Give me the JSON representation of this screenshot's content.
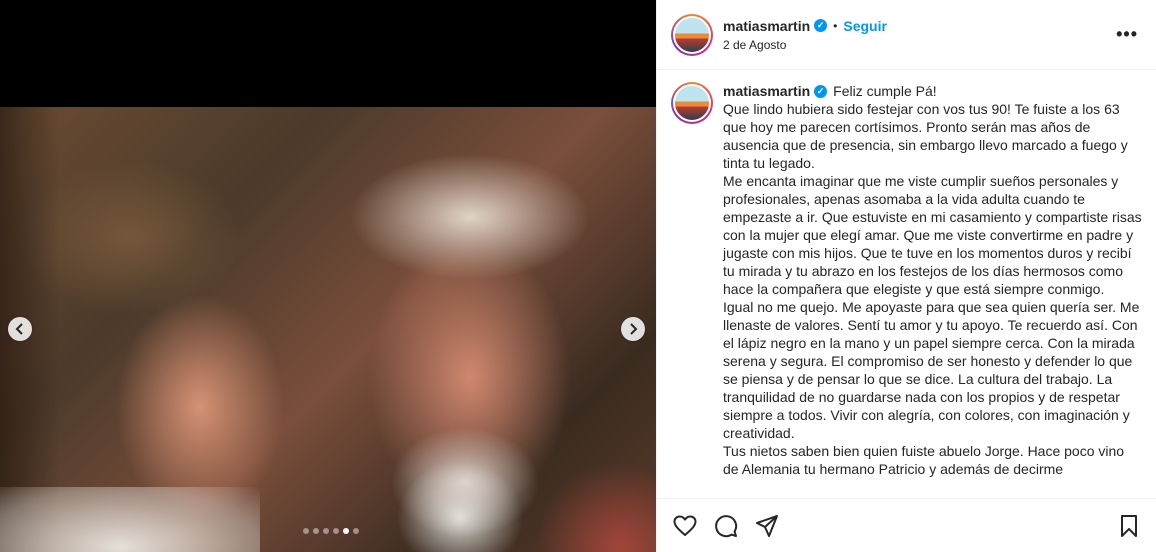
{
  "post": {
    "username": "matiasmartin",
    "separator": "•",
    "follow_label": "Seguir",
    "date": "2 de Agosto",
    "more_label": "•••"
  },
  "media": {
    "prev_icon": "chevron-left-icon",
    "next_icon": "chevron-right-icon",
    "carousel_count": 6,
    "carousel_active_index": 4
  },
  "caption": {
    "username": "matiasmartin",
    "first_line": "Feliz cumple Pá!",
    "paragraphs": [
      "Que lindo hubiera sido festejar con vos tus 90! Te fuiste a los 63 que hoy me parecen cortísimos. Pronto serán mas años de ausencia que de presencia, sin embargo llevo marcado a fuego y tinta tu legado.",
      "Me encanta imaginar que me viste cumplir sueños personales y profesionales, apenas asomaba a la vida adulta cuando te empezaste a ir. Que estuviste en mi casamiento y compartiste risas con la mujer que elegí amar. Que me viste convertirme en padre y jugaste con mis hijos. Que te tuve en los momentos duros y recibí tu mirada y tu abrazo en los festejos de los días hermosos como hace la compañera que elegiste y que está siempre conmigo.",
      "Igual no me quejo. Me apoyaste para que sea quien quería ser. Me llenaste de valores. Sentí tu amor y tu apoyo. Te recuerdo así. Con el lápiz negro en la mano y un papel siempre cerca. Con la mirada serena y segura. El compromiso de ser honesto y defender lo que se piensa y de pensar lo que se dice. La cultura del trabajo. La tranquilidad de no guardarse nada con los propios y de respetar siempre a todos. Vivir con alegría, con colores, con imaginación y creatividad.",
      "Tus nietos saben bien quien fuiste abuelo Jorge. Hace poco vino de Alemania tu hermano Patricio y además de decirme"
    ]
  },
  "actions": {
    "like_icon": "heart-icon",
    "comment_icon": "comment-icon",
    "share_icon": "send-icon",
    "save_icon": "bookmark-icon"
  },
  "colors": {
    "accent": "#0095f6",
    "text": "#262626",
    "border": "#efefef"
  }
}
